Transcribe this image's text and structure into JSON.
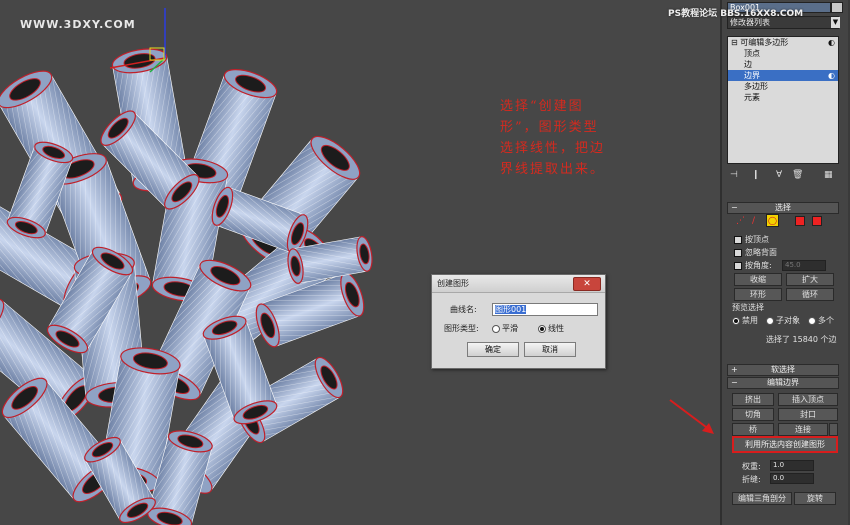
{
  "watermark_left": "WWW.3DXY.COM",
  "watermark_right": "PS教程论坛 BBS.16XX8.COM",
  "annotation": "选择“创建图形”，图形类型选择线性，把边界线提取出来。",
  "colors": {
    "annotation": "#d42a1f",
    "highlight": "#d81d1d",
    "selection": "#3a6fc4",
    "object_name_bg": "#5a6e8a"
  },
  "dialog": {
    "title": "创建图形",
    "close_symbol": "✕",
    "name_label": "曲线名:",
    "name_value": "图形001",
    "shape_type_label": "图形类型:",
    "options": [
      {
        "label": "平滑",
        "selected": false
      },
      {
        "label": "线性",
        "selected": true
      }
    ],
    "ok_label": "确定",
    "cancel_label": "取消"
  },
  "panel": {
    "object_name": "Box001",
    "modifier_list": "修改器列表",
    "stack": {
      "root": "可编辑多边形",
      "items": [
        "顶点",
        "边",
        "边界",
        "多边形",
        "元素"
      ],
      "selected": "边界"
    },
    "selection": {
      "header": "选择",
      "by_vertex": "按顶点",
      "ignore_backfacing": "忽略背面",
      "by_angle": "按角度:",
      "angle_value": "45.0",
      "shrink": "收缩",
      "grow": "扩大",
      "ring": "环形",
      "loop": "循环",
      "preview_label": "预览选择",
      "preview_options": [
        "禁用",
        "子对象",
        "多个"
      ],
      "status": "选择了 15840 个边"
    },
    "soft_selection": "软选择",
    "edit_borders": {
      "header": "编辑边界",
      "extrude": "挤出",
      "insert_vertex": "插入顶点",
      "chamfer": "切角",
      "cap": "封口",
      "bridge": "桥",
      "connect": "连接",
      "create_shape": "利用所选内容创建图形",
      "weight_label": "权重:",
      "weight_value": "1.0",
      "crease_label": "折缝:",
      "crease_value": "0.0",
      "edit_tri": "编辑三角剖分",
      "turn": "旋转"
    }
  }
}
